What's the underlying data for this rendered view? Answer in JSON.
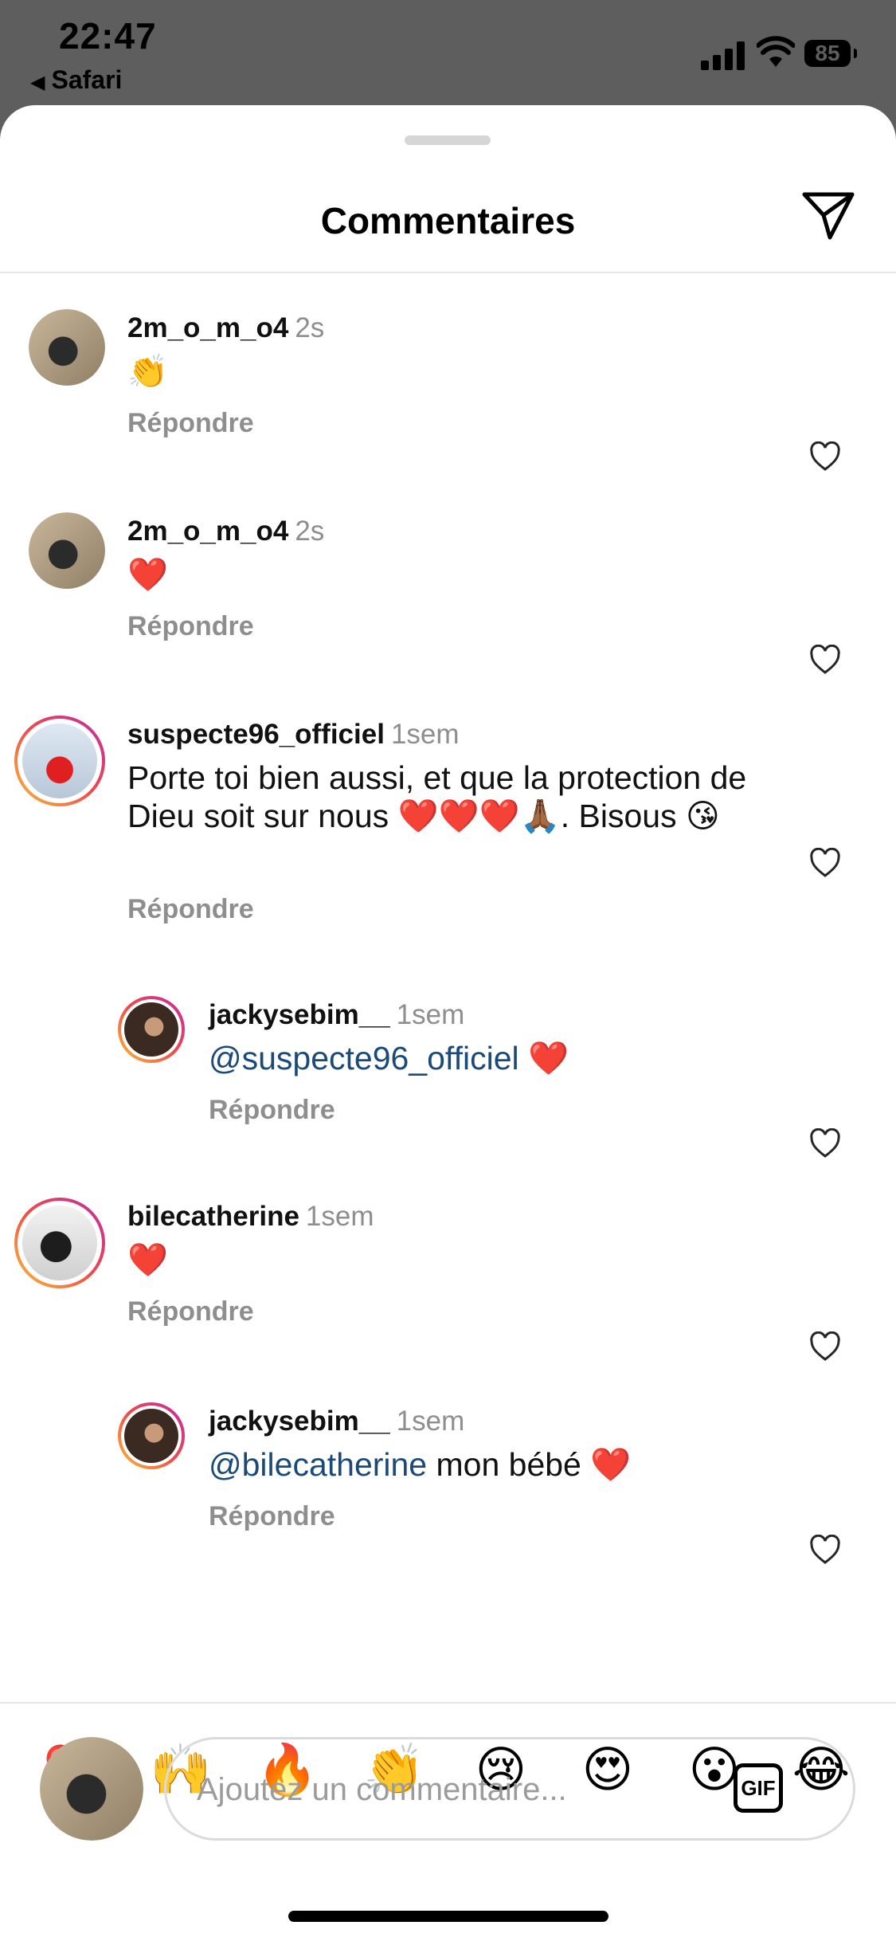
{
  "status_bar": {
    "time": "22:47",
    "back_app": "Safari",
    "battery": "85"
  },
  "sheet": {
    "title": "Commentaires"
  },
  "comments": [
    {
      "username": "2m_o_m_o4",
      "time": "2s",
      "text": "👏",
      "reply": "Répondre"
    },
    {
      "username": "2m_o_m_o4",
      "time": "2s",
      "text": "❤️",
      "reply": "Répondre"
    },
    {
      "username": "suspecte96_officiel",
      "time": "1sem",
      "text": "Porte toi bien aussi, et que la protection de Dieu soit sur nous ❤️❤️❤️🙏🏾. Bisous 😘",
      "reply": "Répondre"
    },
    {
      "username": "jackysebim__",
      "time": "1sem",
      "mention": "@suspecte96_officiel",
      "text": " ❤️",
      "reply": "Répondre"
    },
    {
      "username": "bilecatherine",
      "time": "1sem",
      "text": "❤️",
      "reply": "Répondre"
    },
    {
      "username": "jackysebim__",
      "time": "1sem",
      "mention": "@bilecatherine",
      "text": " mon bébé ❤️",
      "reply": "Répondre"
    }
  ],
  "emoji_bar": [
    "❤️",
    "🙌",
    "🔥",
    "👏",
    "😢",
    "😍",
    "😮",
    "😂"
  ],
  "composer": {
    "placeholder": "Ajoutez un commentaire...",
    "gif_label": "GIF"
  },
  "icons": [
    "signal-icon",
    "wifi-icon",
    "battery-icon",
    "send-icon",
    "heart-icon",
    "gif-icon"
  ]
}
